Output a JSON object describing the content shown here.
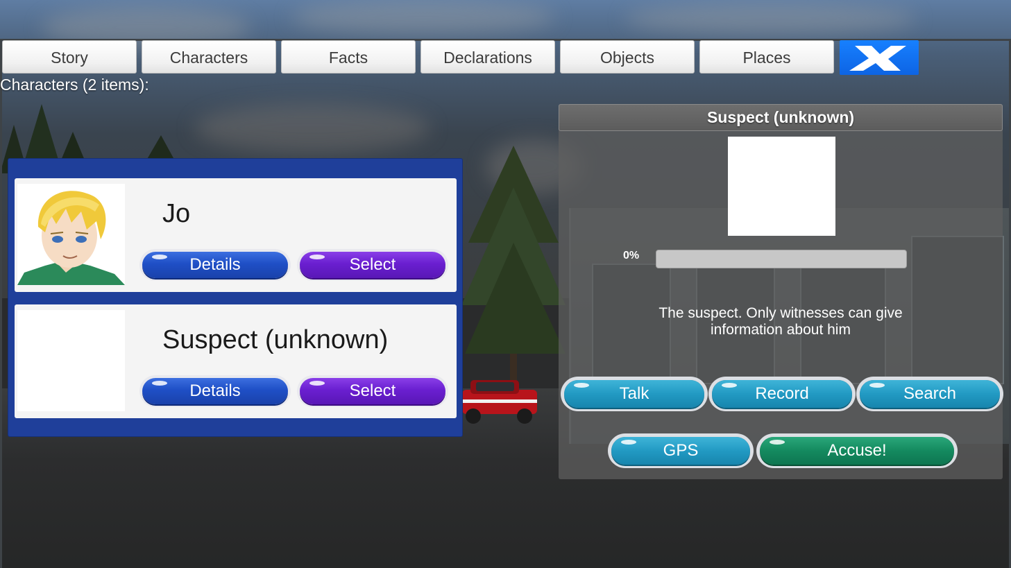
{
  "tabs": {
    "story": "Story",
    "characters": "Characters",
    "facts": "Facts",
    "declarations": "Declarations",
    "objects": "Objects",
    "places": "Places",
    "close_icon": "close-x-icon"
  },
  "list": {
    "heading": "Characters (2 items):",
    "characters": [
      {
        "name": "Jo",
        "details_label": "Details",
        "select_label": "Select"
      },
      {
        "name": "Suspect (unknown)",
        "details_label": "Details",
        "select_label": "Select"
      }
    ]
  },
  "detail": {
    "title": "Suspect (unknown)",
    "progress_text": "0%",
    "progress_value": 0,
    "description": "The suspect. Only witnesses can give information about him",
    "actions": {
      "talk": "Talk",
      "record": "Record",
      "search": "Search",
      "gps": "GPS",
      "accuse": "Accuse!"
    }
  },
  "colors": {
    "tab_close_bg": "#0d64e4",
    "list_panel_bg": "#1f3f9a",
    "details_button": "#1f4fc6",
    "select_button": "#6a1fd0",
    "action_button": "#229ac3",
    "accuse_button": "#148a5f"
  }
}
